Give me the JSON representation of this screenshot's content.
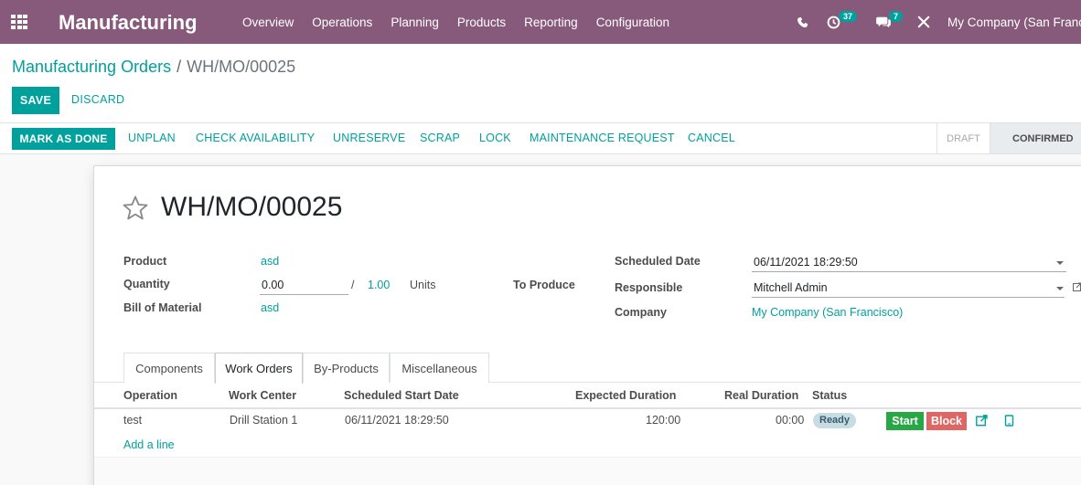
{
  "navbar": {
    "brand": "Manufacturing",
    "menu": [
      "Overview",
      "Operations",
      "Planning",
      "Products",
      "Reporting",
      "Configuration"
    ],
    "activity_count": "37",
    "message_count": "7",
    "company": "My Company (San Francisco)"
  },
  "breadcrumb": {
    "parent": "Manufacturing Orders",
    "separator": "/",
    "current": "WH/MO/00025"
  },
  "actions": {
    "save": "SAVE",
    "discard": "DISCARD"
  },
  "statusbar": {
    "buttons": [
      "MARK AS DONE",
      "UNPLAN",
      "CHECK AVAILABILITY",
      "UNRESERVE",
      "SCRAP",
      "LOCK",
      "MAINTENANCE REQUEST",
      "CANCEL"
    ],
    "stages": [
      "DRAFT",
      "CONFIRMED"
    ],
    "current_stage": "CONFIRMED"
  },
  "form": {
    "title": "WH/MO/00025",
    "product_label": "Product",
    "product": "asd",
    "quantity_label": "Quantity",
    "quantity_produced": "0.00",
    "quantity_sep": "/",
    "quantity_target": "1.00",
    "quantity_uom": "Units",
    "to_produce": "To Produce",
    "bom_label": "Bill of Material",
    "bom": "asd",
    "scheduled_date_label": "Scheduled Date",
    "scheduled_date": "06/11/2021 18:29:50",
    "responsible_label": "Responsible",
    "responsible": "Mitchell Admin",
    "company_label": "Company",
    "company": "My Company (San Francisco)"
  },
  "tabs": [
    "Components",
    "Work Orders",
    "By-Products",
    "Miscellaneous"
  ],
  "active_tab": "Work Orders",
  "work_orders": {
    "columns": [
      "Operation",
      "Work Center",
      "Scheduled Start Date",
      "Expected Duration",
      "Real Duration",
      "Status"
    ],
    "rows": [
      {
        "operation": "test",
        "work_center": "Drill Station 1",
        "start": "06/11/2021 18:29:50",
        "expected": "120:00",
        "real": "00:00",
        "status": "Ready",
        "start_btn": "Start",
        "block_btn": "Block"
      }
    ],
    "add_line": "Add a line"
  },
  "colors": {
    "navbar": "#875a7b",
    "primary": "#00a09d",
    "start": "#28a745",
    "block": "#e06666",
    "status_pill": "#c8dde3"
  }
}
